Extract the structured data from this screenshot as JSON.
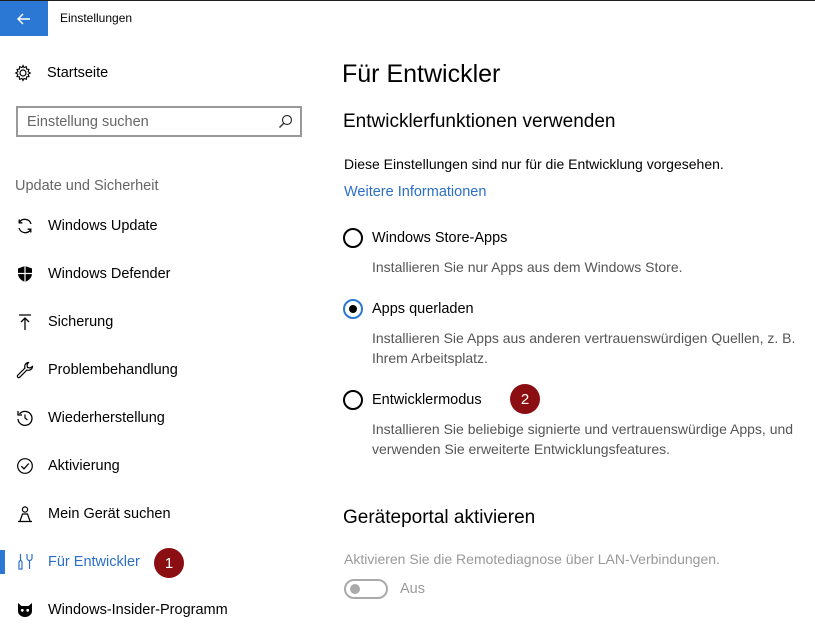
{
  "window": {
    "title": "Einstellungen"
  },
  "sidebar": {
    "home_label": "Startseite",
    "search_placeholder": "Einstellung suchen",
    "section_label": "Update und Sicherheit",
    "items": [
      {
        "label": "Windows Update",
        "icon": "sync-icon"
      },
      {
        "label": "Windows Defender",
        "icon": "shield-icon"
      },
      {
        "label": "Sicherung",
        "icon": "backup-arrow-icon"
      },
      {
        "label": "Problembehandlung",
        "icon": "wrench-icon"
      },
      {
        "label": "Wiederherstellung",
        "icon": "recovery-icon"
      },
      {
        "label": "Aktivierung",
        "icon": "check-circle-icon"
      },
      {
        "label": "Mein Gerät suchen",
        "icon": "person-location-icon"
      },
      {
        "label": "Für Entwickler",
        "icon": "developer-tools-icon",
        "active": true
      },
      {
        "label": "Windows-Insider-Programm",
        "icon": "insider-cat-icon"
      }
    ]
  },
  "markers": {
    "m1": "1",
    "m2": "2"
  },
  "main": {
    "title": "Für Entwickler",
    "section1": "Entwicklerfunktionen verwenden",
    "description": "Diese Einstellungen sind nur für die Entwicklung vorgesehen.",
    "link": "Weitere Informationen",
    "options": [
      {
        "label": "Windows Store-Apps",
        "desc": "Installieren Sie nur Apps aus dem Windows Store.",
        "checked": false
      },
      {
        "label": "Apps querladen",
        "desc": "Installieren Sie Apps aus anderen vertrauenswürdigen Quellen, z. B. Ihrem Arbeitsplatz.",
        "checked": true
      },
      {
        "label": "Entwicklermodus",
        "desc": "Installieren Sie beliebige signierte und vertrauenswürdige Apps, und verwenden Sie erweiterte Entwicklungsfeatures.",
        "checked": false
      }
    ],
    "section2": "Geräteportal aktivieren",
    "portal_desc": "Aktivieren Sie die Remotediagnose über LAN-Verbindungen.",
    "toggle_label": "Aus",
    "toggle_on": false
  },
  "colors": {
    "accent": "#2b78d4",
    "marker": "#8b0f12"
  }
}
